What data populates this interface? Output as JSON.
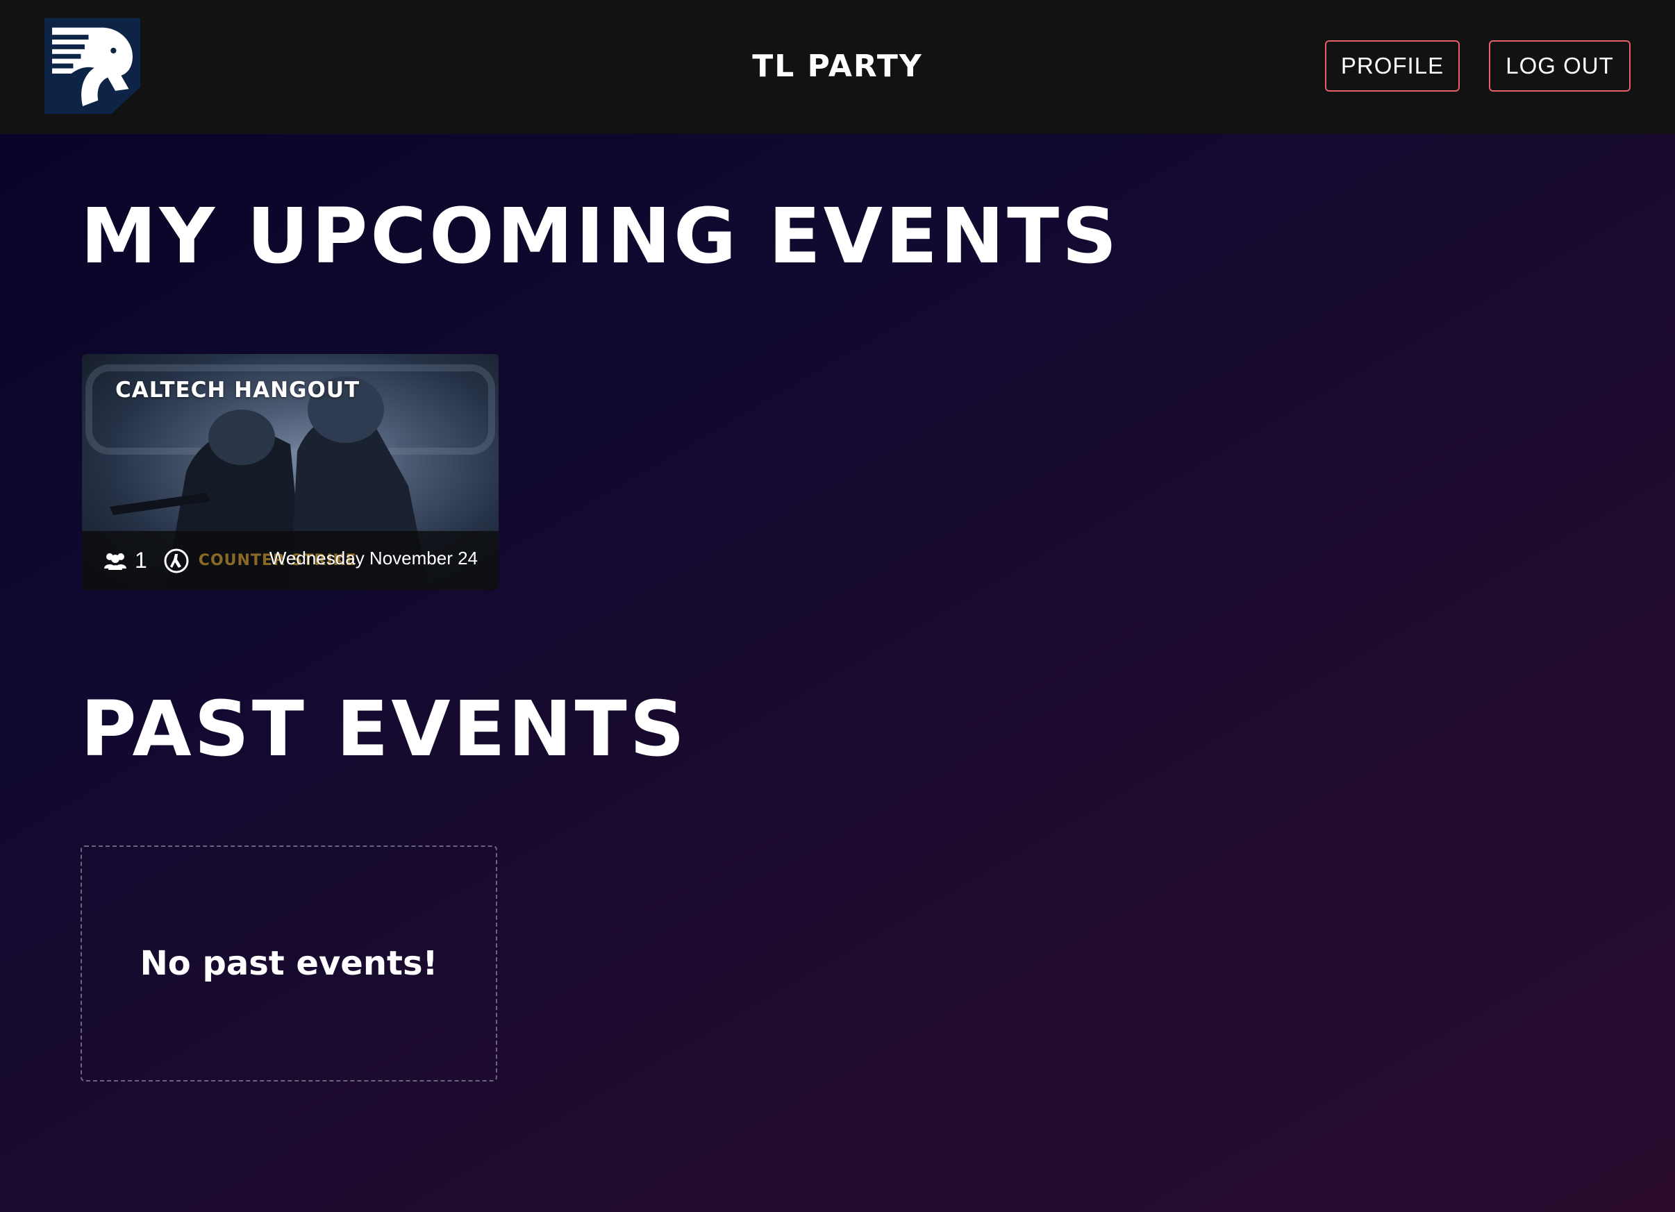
{
  "header": {
    "app_title": "TL PARTY",
    "profile_label": "PROFILE",
    "logout_label": "LOG OUT",
    "accent_color": "#e8606a",
    "logo_icon": "team-liquid-horse-logo"
  },
  "upcoming": {
    "heading": "MY UPCOMING EVENTS",
    "events": [
      {
        "title": "CALTECH HANGOUT",
        "attendees": "1",
        "game_icon": "counter-strike-icon",
        "game_wordmark": "COUNTER STRIKE",
        "date": "Wednesday November 24"
      }
    ]
  },
  "past": {
    "heading": "PAST EVENTS",
    "empty_message": "No past events!"
  }
}
